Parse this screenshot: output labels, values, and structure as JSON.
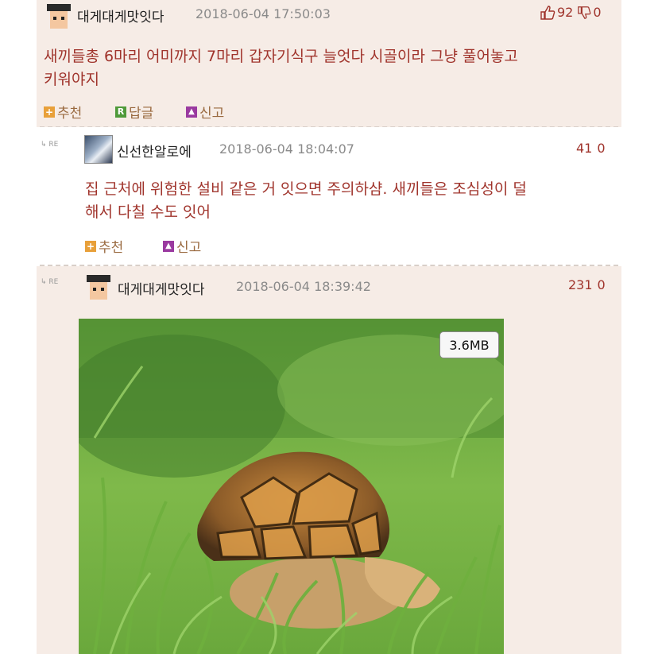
{
  "comments": [
    {
      "author": "대게대게맛잇다",
      "date": "2018-06-04 17:50:03",
      "text_line1": "새끼들총 6마리 어미까지 7마리 갑자기식구 늘엇다 시골이라 그냥 풀어놓고",
      "text_line2": "키워야지",
      "upvotes": "92",
      "downvotes": "0",
      "actions": {
        "recommend": "추천",
        "reply": "답글",
        "report": "신고"
      }
    },
    {
      "re_label": "RE",
      "author": "신선한알로에",
      "date": "2018-06-04 18:04:07",
      "text_line1": "집 근처에 위험한 설비 같은 거 잇으면 주의하샴. 새끼들은 조심성이 덜",
      "text_line2": "해서 다칠 수도 잇어",
      "upvotes": "41",
      "downvotes": "0",
      "actions": {
        "recommend": "추천",
        "report": "신고"
      }
    },
    {
      "re_label": "RE",
      "author": "대게대게맛잇다",
      "date": "2018-06-04 18:39:42",
      "upvotes": "231",
      "downvotes": "0",
      "image_size": "3.6MB"
    }
  ],
  "icons": {
    "recommend": "plus-square-icon",
    "reply": "reply-square-icon",
    "report": "siren-icon",
    "upvote": "thumbs-up-icon",
    "downvote": "thumbs-down-icon"
  },
  "colors": {
    "post_bg": "#f6ece6",
    "text_red": "#a0342c",
    "action_brown": "#9a6a40"
  }
}
